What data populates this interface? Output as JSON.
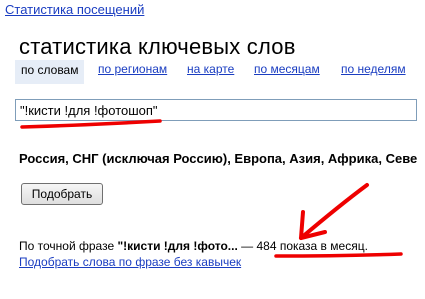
{
  "header": {
    "breadcrumb_link": "Статистика посещений"
  },
  "page": {
    "title": "статистика ключевых слов"
  },
  "tabs": [
    {
      "label": "по словам",
      "active": true
    },
    {
      "label": "по регионам",
      "active": false
    },
    {
      "label": "на карте",
      "active": false
    },
    {
      "label": "по месяцам",
      "active": false
    },
    {
      "label": "по неделям",
      "active": false
    }
  ],
  "search": {
    "value": "\"!кисти !для !фотошоп\""
  },
  "regions": {
    "text": "Россия, СНГ (исключая Россию), Европа, Азия, Африка, Севе"
  },
  "submit": {
    "label": "Подобрать"
  },
  "result": {
    "prefix": "По точной фразе ",
    "phrase": "\"!кисти !для !фото...",
    "dash": " — ",
    "count_text": "484 показа в месяц."
  },
  "no_quotes_link": "Подобрать слова по фразе без кавычек",
  "annotation_color": "#ee0000"
}
